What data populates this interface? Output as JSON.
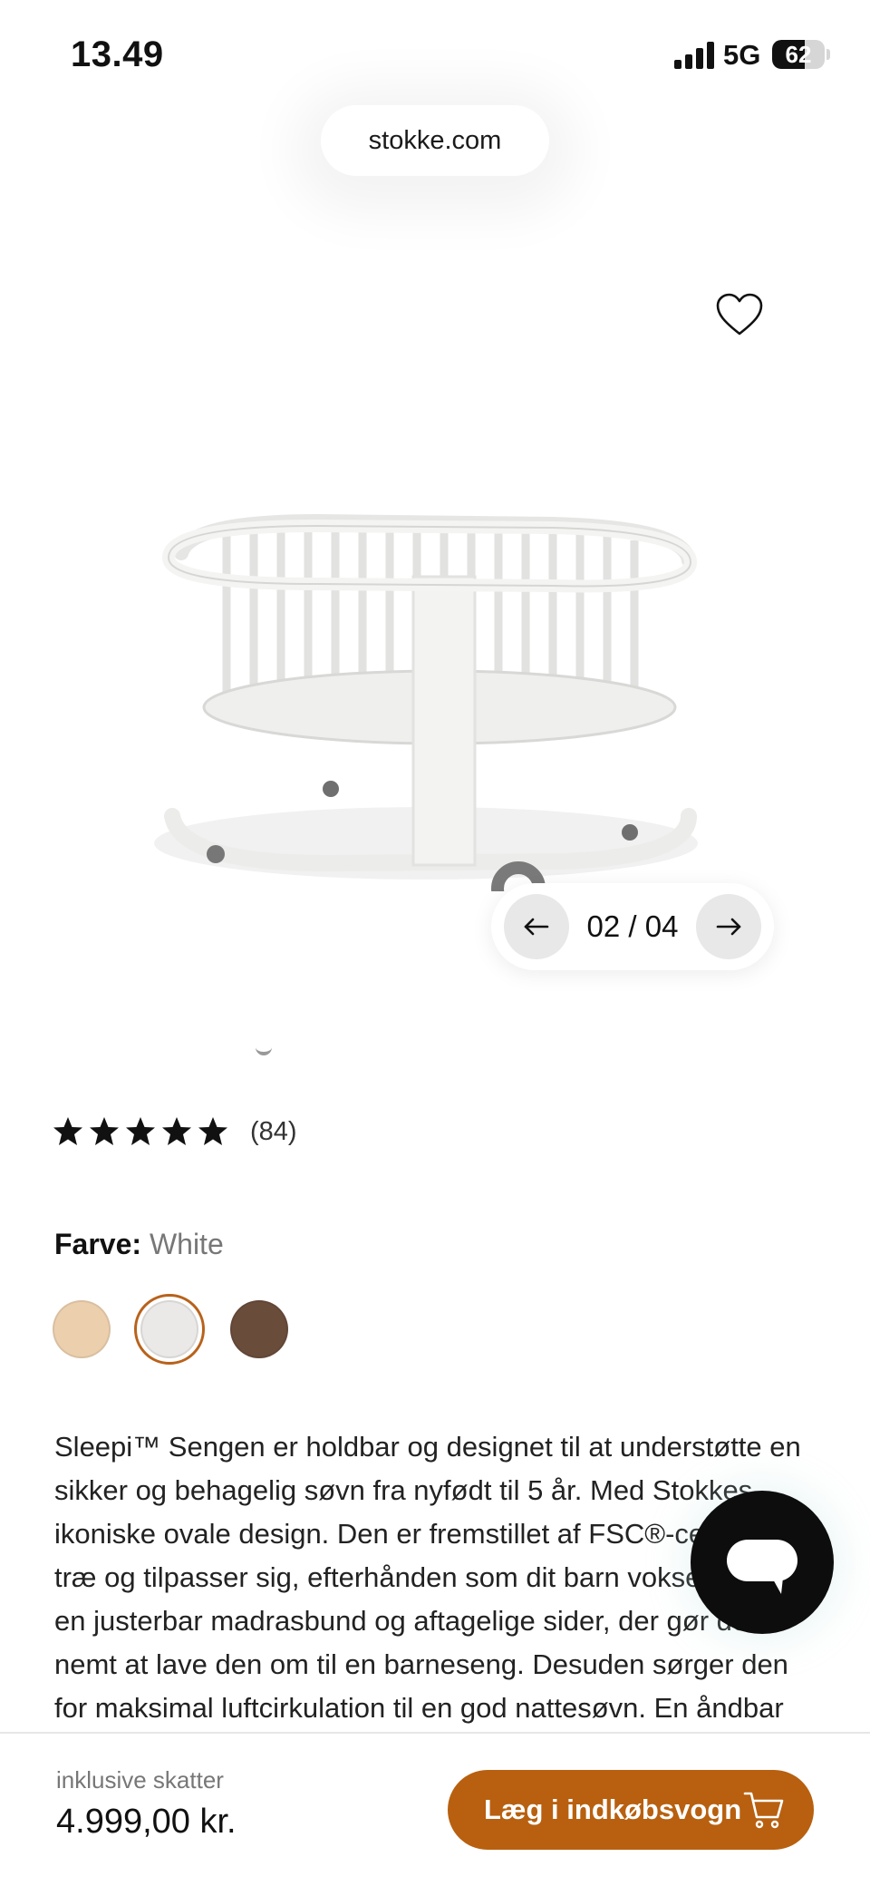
{
  "status_bar": {
    "time": "13.49",
    "network": "5G",
    "battery": "62",
    "battery_level": 0.62,
    "signal_icon": "cellular-signal-icon"
  },
  "browser": {
    "url": "stokke.com"
  },
  "gallery": {
    "counter": "02 / 04",
    "prev_icon": "arrow-left-icon",
    "next_icon": "arrow-right-icon",
    "wishlist_icon": "heart-icon"
  },
  "rating": {
    "stars": 5,
    "count": "(84)"
  },
  "color": {
    "label": "Farve:",
    "value": "White",
    "swatches": [
      {
        "name": "Natural",
        "hex": "#ecd0ae"
      },
      {
        "name": "White",
        "hex": "#ebe9e7",
        "selected": true
      },
      {
        "name": "Walnut",
        "hex": "#6a4c3b"
      }
    ]
  },
  "description": {
    "lines": [
      "Sleepi™ Sengen er holdbar og designet til at understøtte en",
      "sikker og behagelig søvn fra nyfødt til 5 år. Med Stokkes",
      "ikoniske ovale design. Den er fremstillet af FSC®-certificeret",
      "træ og tilpasser sig, efterhånden som dit barn vokser, med",
      "en justerbar madrasbund og aftagelige sider, der gør det",
      "nemt at lave den om til en barneseng. Desuden sørger den",
      "for maksimal luftcirkulation til en god nattesøvn. En åndbar"
    ]
  },
  "chat": {
    "icon": "chat-bubble-icon"
  },
  "purchase": {
    "tax_label": "inklusive skatter",
    "price": "4.999,00 kr.",
    "cart_button": "Læg i indkøbsvogn",
    "cart_icon": "shopping-cart-icon",
    "accent_color": "#b8600f"
  }
}
